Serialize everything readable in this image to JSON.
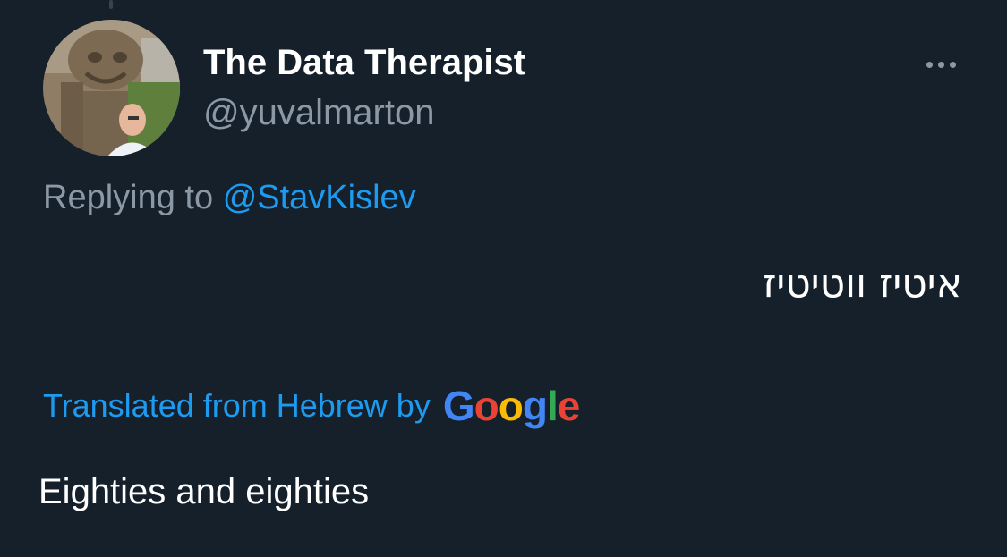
{
  "tweet": {
    "author": {
      "display_name": "The Data Therapist",
      "handle": "@yuvalmarton",
      "avatar_icon": "profile-photo"
    },
    "more_icon": "more-horizontal-icon",
    "reply_context": {
      "prefix": "Replying to",
      "mention": "@StavKislev"
    },
    "original_text": "איטיז ווטיטיז",
    "translation": {
      "label": "Translated from Hebrew by",
      "provider_logo": {
        "letters": [
          "G",
          "o",
          "o",
          "g",
          "l",
          "e"
        ],
        "colors": [
          "#4285F4",
          "#EA4335",
          "#FBBC05",
          "#4285F4",
          "#34A853",
          "#EA4335"
        ]
      },
      "text": "Eighties and eighties"
    }
  },
  "colors": {
    "background": "#15202b",
    "primary_text": "#ffffff",
    "secondary_text": "#8b98a5",
    "accent": "#1d9bf0"
  }
}
